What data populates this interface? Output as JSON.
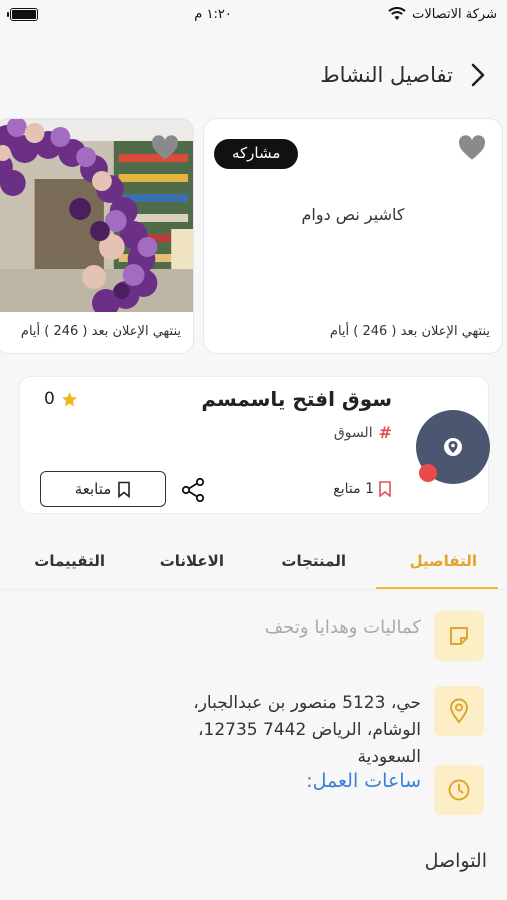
{
  "status_bar": {
    "carrier": "شركة الاتصالات",
    "time": "١:٢٠ م"
  },
  "header": {
    "title": "تفاصيل النشاط"
  },
  "ads": [
    {
      "badge": "مشاركه",
      "title": "كاشير نص دوام",
      "expiry": "ينتهي الإعلان بعد ( 246 ) أيام"
    },
    {
      "expiry": "ينتهي الإعلان بعد ( 246 ) أيام"
    }
  ],
  "store": {
    "name": "سوق افتح ياسمسم",
    "rating": "0",
    "category": "السوق",
    "followers": "1 متابع",
    "follow_label": "متابعة"
  },
  "tabs": [
    "التفاصيل",
    "المنتجات",
    "الاعلانات",
    "التقييمات"
  ],
  "details": {
    "description": "كماليات وهدايا وتحف",
    "address": "حي، 5123 منصور بن عبدالجبار، الوشام، الرياض 7442 12735، السعودية",
    "hours_label": "ساعات العمل:"
  },
  "contact_title": "التواصل",
  "colors": {
    "accent": "#f0b83a",
    "logo_bg": "#4b5670",
    "link": "#3b7fd8"
  }
}
